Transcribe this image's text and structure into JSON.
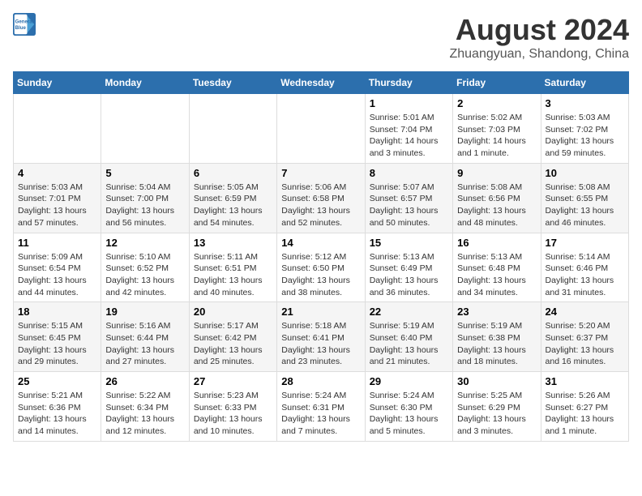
{
  "logo": {
    "line1": "General",
    "line2": "Blue"
  },
  "title": "August 2024",
  "subtitle": "Zhuangyuan, Shandong, China",
  "weekdays": [
    "Sunday",
    "Monday",
    "Tuesday",
    "Wednesday",
    "Thursday",
    "Friday",
    "Saturday"
  ],
  "weeks": [
    [
      {
        "day": "",
        "info": ""
      },
      {
        "day": "",
        "info": ""
      },
      {
        "day": "",
        "info": ""
      },
      {
        "day": "",
        "info": ""
      },
      {
        "day": "1",
        "info": "Sunrise: 5:01 AM\nSunset: 7:04 PM\nDaylight: 14 hours\nand 3 minutes."
      },
      {
        "day": "2",
        "info": "Sunrise: 5:02 AM\nSunset: 7:03 PM\nDaylight: 14 hours\nand 1 minute."
      },
      {
        "day": "3",
        "info": "Sunrise: 5:03 AM\nSunset: 7:02 PM\nDaylight: 13 hours\nand 59 minutes."
      }
    ],
    [
      {
        "day": "4",
        "info": "Sunrise: 5:03 AM\nSunset: 7:01 PM\nDaylight: 13 hours\nand 57 minutes."
      },
      {
        "day": "5",
        "info": "Sunrise: 5:04 AM\nSunset: 7:00 PM\nDaylight: 13 hours\nand 56 minutes."
      },
      {
        "day": "6",
        "info": "Sunrise: 5:05 AM\nSunset: 6:59 PM\nDaylight: 13 hours\nand 54 minutes."
      },
      {
        "day": "7",
        "info": "Sunrise: 5:06 AM\nSunset: 6:58 PM\nDaylight: 13 hours\nand 52 minutes."
      },
      {
        "day": "8",
        "info": "Sunrise: 5:07 AM\nSunset: 6:57 PM\nDaylight: 13 hours\nand 50 minutes."
      },
      {
        "day": "9",
        "info": "Sunrise: 5:08 AM\nSunset: 6:56 PM\nDaylight: 13 hours\nand 48 minutes."
      },
      {
        "day": "10",
        "info": "Sunrise: 5:08 AM\nSunset: 6:55 PM\nDaylight: 13 hours\nand 46 minutes."
      }
    ],
    [
      {
        "day": "11",
        "info": "Sunrise: 5:09 AM\nSunset: 6:54 PM\nDaylight: 13 hours\nand 44 minutes."
      },
      {
        "day": "12",
        "info": "Sunrise: 5:10 AM\nSunset: 6:52 PM\nDaylight: 13 hours\nand 42 minutes."
      },
      {
        "day": "13",
        "info": "Sunrise: 5:11 AM\nSunset: 6:51 PM\nDaylight: 13 hours\nand 40 minutes."
      },
      {
        "day": "14",
        "info": "Sunrise: 5:12 AM\nSunset: 6:50 PM\nDaylight: 13 hours\nand 38 minutes."
      },
      {
        "day": "15",
        "info": "Sunrise: 5:13 AM\nSunset: 6:49 PM\nDaylight: 13 hours\nand 36 minutes."
      },
      {
        "day": "16",
        "info": "Sunrise: 5:13 AM\nSunset: 6:48 PM\nDaylight: 13 hours\nand 34 minutes."
      },
      {
        "day": "17",
        "info": "Sunrise: 5:14 AM\nSunset: 6:46 PM\nDaylight: 13 hours\nand 31 minutes."
      }
    ],
    [
      {
        "day": "18",
        "info": "Sunrise: 5:15 AM\nSunset: 6:45 PM\nDaylight: 13 hours\nand 29 minutes."
      },
      {
        "day": "19",
        "info": "Sunrise: 5:16 AM\nSunset: 6:44 PM\nDaylight: 13 hours\nand 27 minutes."
      },
      {
        "day": "20",
        "info": "Sunrise: 5:17 AM\nSunset: 6:42 PM\nDaylight: 13 hours\nand 25 minutes."
      },
      {
        "day": "21",
        "info": "Sunrise: 5:18 AM\nSunset: 6:41 PM\nDaylight: 13 hours\nand 23 minutes."
      },
      {
        "day": "22",
        "info": "Sunrise: 5:19 AM\nSunset: 6:40 PM\nDaylight: 13 hours\nand 21 minutes."
      },
      {
        "day": "23",
        "info": "Sunrise: 5:19 AM\nSunset: 6:38 PM\nDaylight: 13 hours\nand 18 minutes."
      },
      {
        "day": "24",
        "info": "Sunrise: 5:20 AM\nSunset: 6:37 PM\nDaylight: 13 hours\nand 16 minutes."
      }
    ],
    [
      {
        "day": "25",
        "info": "Sunrise: 5:21 AM\nSunset: 6:36 PM\nDaylight: 13 hours\nand 14 minutes."
      },
      {
        "day": "26",
        "info": "Sunrise: 5:22 AM\nSunset: 6:34 PM\nDaylight: 13 hours\nand 12 minutes."
      },
      {
        "day": "27",
        "info": "Sunrise: 5:23 AM\nSunset: 6:33 PM\nDaylight: 13 hours\nand 10 minutes."
      },
      {
        "day": "28",
        "info": "Sunrise: 5:24 AM\nSunset: 6:31 PM\nDaylight: 13 hours\nand 7 minutes."
      },
      {
        "day": "29",
        "info": "Sunrise: 5:24 AM\nSunset: 6:30 PM\nDaylight: 13 hours\nand 5 minutes."
      },
      {
        "day": "30",
        "info": "Sunrise: 5:25 AM\nSunset: 6:29 PM\nDaylight: 13 hours\nand 3 minutes."
      },
      {
        "day": "31",
        "info": "Sunrise: 5:26 AM\nSunset: 6:27 PM\nDaylight: 13 hours\nand 1 minute."
      }
    ]
  ]
}
